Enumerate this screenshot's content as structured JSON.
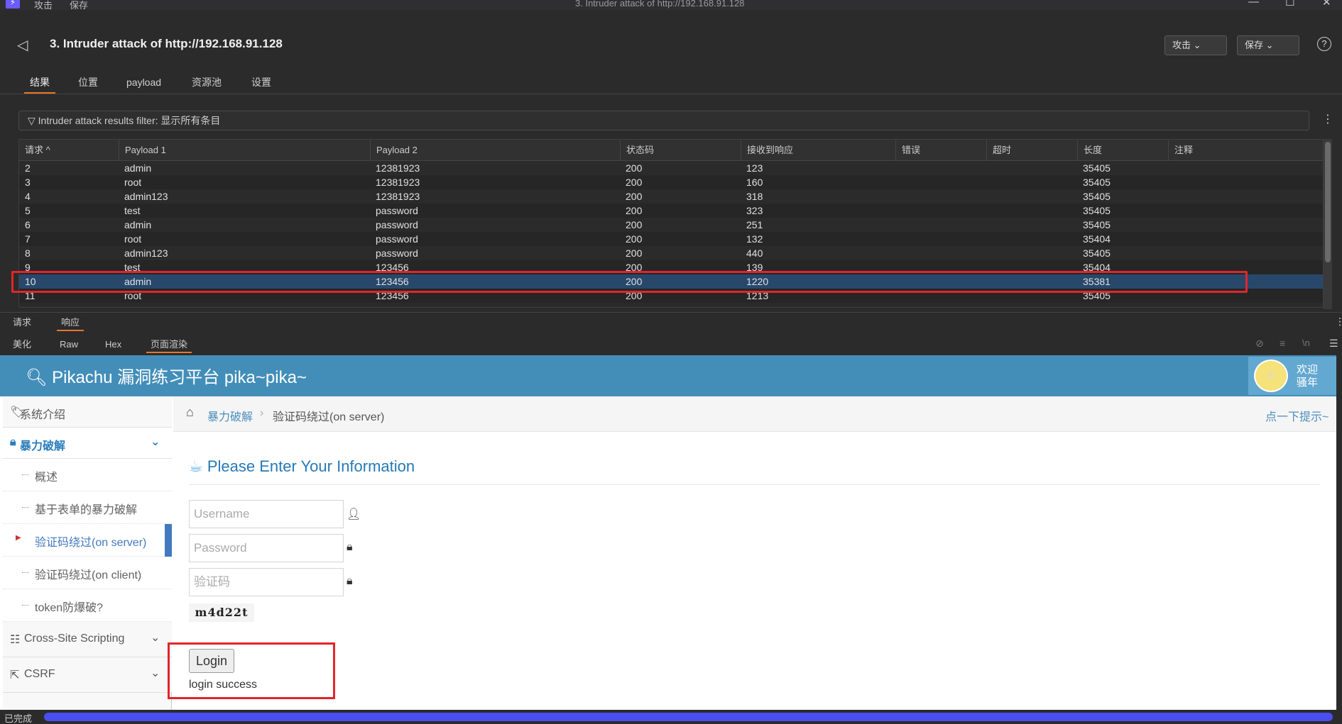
{
  "titlebar": {
    "menu": [
      "攻击",
      "保存"
    ],
    "window_title": "3. Intruder attack of http://192.168.91.128"
  },
  "header": {
    "title": "3. Intruder attack of http://192.168.91.128",
    "attack_btn": "攻击",
    "save_btn": "保存",
    "help": "?"
  },
  "tabs": [
    "结果",
    "位置",
    "payload",
    "资源池",
    "设置"
  ],
  "filter": {
    "label": "Intruder attack results filter: 显示所有条目"
  },
  "table": {
    "columns": [
      "请求 ^",
      "Payload 1",
      "Payload 2",
      "状态码",
      "接收到响应",
      "错误",
      "超时",
      "长度",
      "注释"
    ],
    "rows": [
      [
        "2",
        "admin",
        "12381923",
        "200",
        "123",
        "",
        "",
        "35405",
        ""
      ],
      [
        "3",
        "root",
        "12381923",
        "200",
        "160",
        "",
        "",
        "35405",
        ""
      ],
      [
        "4",
        "admin123",
        "12381923",
        "200",
        "318",
        "",
        "",
        "35405",
        ""
      ],
      [
        "5",
        "test",
        "password",
        "200",
        "323",
        "",
        "",
        "35405",
        ""
      ],
      [
        "6",
        "admin",
        "password",
        "200",
        "251",
        "",
        "",
        "35405",
        ""
      ],
      [
        "7",
        "root",
        "password",
        "200",
        "132",
        "",
        "",
        "35404",
        ""
      ],
      [
        "8",
        "admin123",
        "password",
        "200",
        "440",
        "",
        "",
        "35405",
        ""
      ],
      [
        "9",
        "test",
        "123456",
        "200",
        "139",
        "",
        "",
        "35404",
        ""
      ],
      [
        "10",
        "admin",
        "123456",
        "200",
        "1220",
        "",
        "",
        "35381",
        ""
      ],
      [
        "11",
        "root",
        "123456",
        "200",
        "1213",
        "",
        "",
        "35405",
        ""
      ]
    ],
    "selected_row": "10"
  },
  "reqres_tabs": [
    "请求",
    "响应"
  ],
  "view_tabs": [
    "美化",
    "Raw",
    "Hex",
    "页面渲染"
  ],
  "rendered": {
    "banner_title": "Pikachu 漏洞练习平台 pika~pika~",
    "welcome": "欢迎 骚年",
    "sidebar": {
      "intro": "系统介绍",
      "brute": "暴力破解",
      "subs": [
        "概述",
        "基于表单的暴力破解",
        "验证码绕过(on server)",
        "验证码绕过(on client)",
        "token防爆破?"
      ],
      "xss": "Cross-Site Scripting",
      "csrf": "CSRF"
    },
    "breadcrumb": {
      "home": "暴力破解",
      "current": "验证码绕过(on server)",
      "hint": "点一下提示~"
    },
    "heading": "Please Enter Your Information",
    "username_placeholder": "Username",
    "password_placeholder": "Password",
    "captcha_placeholder": "验证码",
    "captcha_text": "m4d22t",
    "login_btn": "Login",
    "result": "login success"
  },
  "status": {
    "text": "已完成",
    "progress": 1.0
  }
}
